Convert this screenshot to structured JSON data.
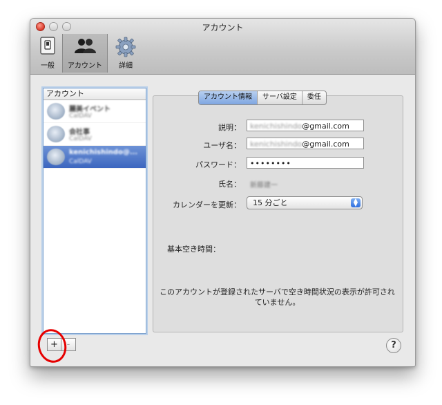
{
  "window": {
    "title": "アカウント"
  },
  "toolbar": {
    "general_label": "一般",
    "account_label": "アカウント",
    "advanced_label": "詳細"
  },
  "sidebar": {
    "header": "アカウント",
    "accounts": [
      {
        "name": "麗美イベント",
        "sub": "CalDAV"
      },
      {
        "name": "会社事",
        "sub": "CalDAV"
      },
      {
        "name": "kenichishindo@...",
        "sub": "CalDAV"
      }
    ],
    "add_label": "+",
    "remove_label": "-"
  },
  "tabs": [
    "アカウント情報",
    "サーバ設定",
    "委任"
  ],
  "form": {
    "description_label": "説明：",
    "description_hidden": "kenichishindo",
    "description_visible": "@gmail.com",
    "username_label": "ユーザ名：",
    "username_hidden": "kenichishindo",
    "username_visible": "@gmail.com",
    "password_label": "パスワード：",
    "password_value": "••••••••",
    "fullname_label": "氏名：",
    "fullname_value": "新藤建一",
    "refresh_label": "カレンダーを更新：",
    "refresh_value": "15 分ごと"
  },
  "availability_label": "基本空き時間：",
  "availability_notice": "このアカウントが登録されたサーバで空き時間状況の表示が許可されていません。",
  "help_label": "?"
}
